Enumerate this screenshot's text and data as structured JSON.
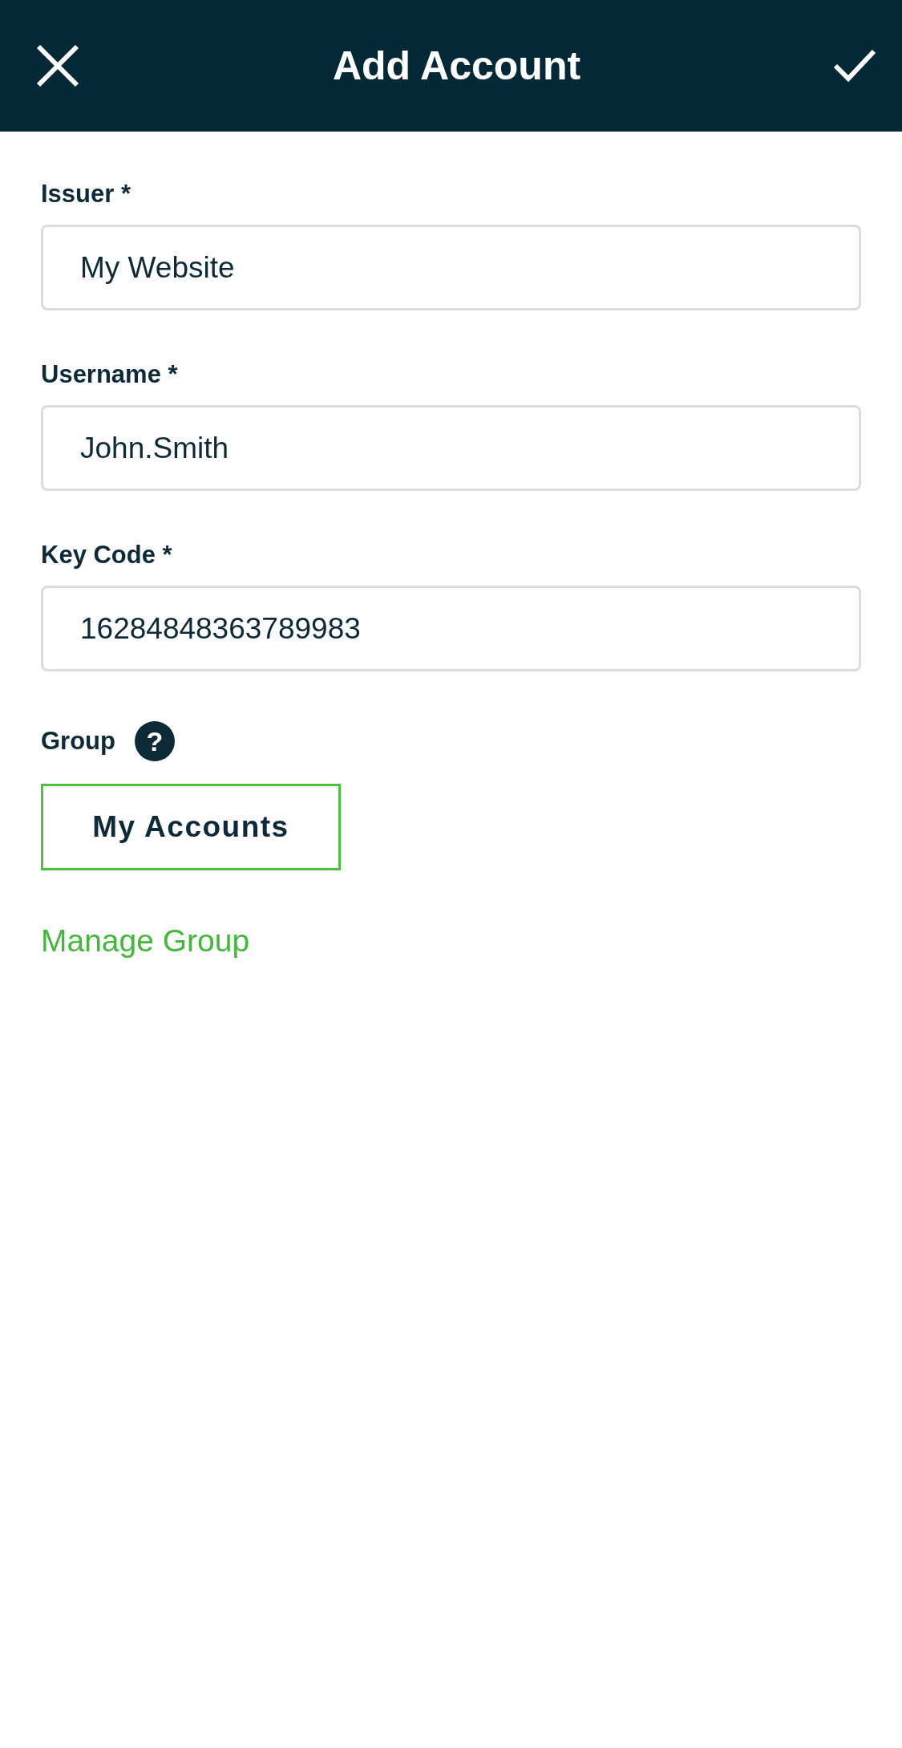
{
  "header": {
    "title": "Add Account"
  },
  "fields": [
    {
      "label": "Issuer *",
      "value": "My Website"
    },
    {
      "label": "Username *",
      "value": "John.Smith"
    },
    {
      "label": "Key Code *",
      "value": "16284848363789983"
    }
  ],
  "group": {
    "label": "Group",
    "help": "?",
    "value": "My Accounts"
  },
  "manage_link": "Manage Group"
}
